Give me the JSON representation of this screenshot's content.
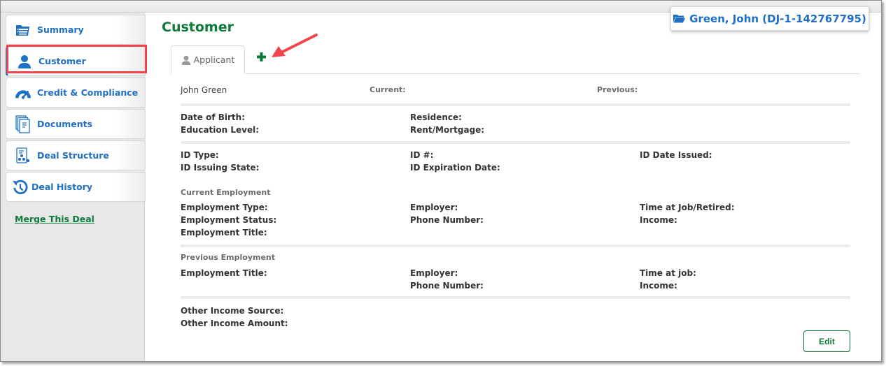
{
  "sidebar": {
    "items": [
      {
        "label": "Summary",
        "icon": "list-folder-icon"
      },
      {
        "label": "Customer",
        "icon": "user-icon",
        "active": true
      },
      {
        "label": "Credit & Compliance",
        "icon": "gauge-icon"
      },
      {
        "label": "Documents",
        "icon": "documents-icon"
      },
      {
        "label": "Deal Structure",
        "icon": "deal-structure-icon"
      },
      {
        "label": "Deal History",
        "icon": "history-icon"
      }
    ],
    "merge_link": "Merge This Deal"
  },
  "header": {
    "title": "Customer",
    "deal_badge": "Green, John (DJ-1-142767795)"
  },
  "tabs": {
    "applicant_label": "Applicant",
    "add_label": "+"
  },
  "customer": {
    "name": "John Green",
    "current_label": "Current:",
    "previous_label": "Previous:",
    "personal": {
      "dob": "Date of Birth:",
      "education": "Education Level:",
      "residence": "Residence:",
      "rent": "Rent/Mortgage:"
    },
    "id": {
      "type": "ID Type:",
      "issuing_state": "ID Issuing State:",
      "number": "ID #:",
      "expiration": "ID Expiration Date:",
      "issued": "ID Date Issued:"
    },
    "current_employment": {
      "heading": "Current Employment",
      "type": "Employment Type:",
      "status": "Employment Status:",
      "title": "Employment Title:",
      "employer": "Employer:",
      "phone": "Phone Number:",
      "time": "Time at Job/Retired:",
      "income": "Income:"
    },
    "previous_employment": {
      "heading": "Previous Employment",
      "title": "Employment Title:",
      "employer": "Employer:",
      "phone": "Phone Number:",
      "time": "Time at job:",
      "income": "Income:"
    },
    "other_income": {
      "source": "Other Income Source:",
      "amount": "Other Income Amount:"
    }
  },
  "actions": {
    "edit_label": "Edit"
  },
  "colors": {
    "accent_blue": "#1f6fc5",
    "accent_green": "#0e7a3a",
    "highlight_red": "#f0454b"
  }
}
